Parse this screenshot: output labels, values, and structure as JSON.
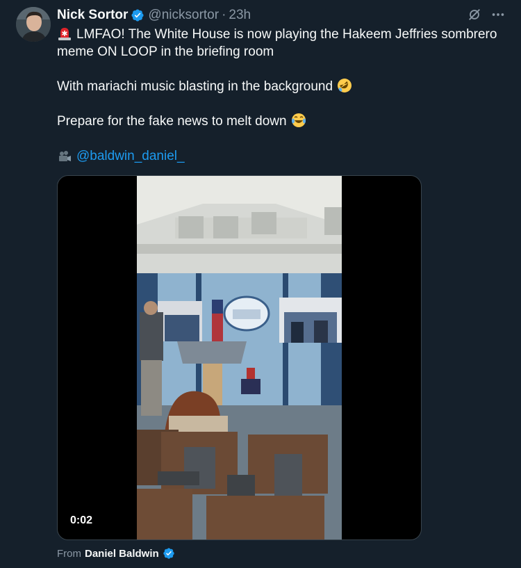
{
  "author": {
    "name": "Nick Sortor",
    "handle": "@nicksortor",
    "separator": "·",
    "time": "23h",
    "verified_color": "#1d9bf0"
  },
  "tweet": {
    "line1": "LMFAO! The White House is now playing the Hakeem Jeffries sombrero meme ON LOOP in the briefing room",
    "line2": "With mariachi music blasting in the background",
    "line3": "Prepare for the fake news to melt down",
    "credit_handle": "@baldwin_daniel_"
  },
  "media": {
    "duration": "0:02"
  },
  "attribution": {
    "prefix": "From",
    "name": "Daniel Baldwin"
  },
  "icons": [
    "grok-icon",
    "more-icon",
    "siren-emoji",
    "rolling-laughing-emoji",
    "tears-of-joy-emoji",
    "video-camera-emoji",
    "verified-badge-icon"
  ]
}
